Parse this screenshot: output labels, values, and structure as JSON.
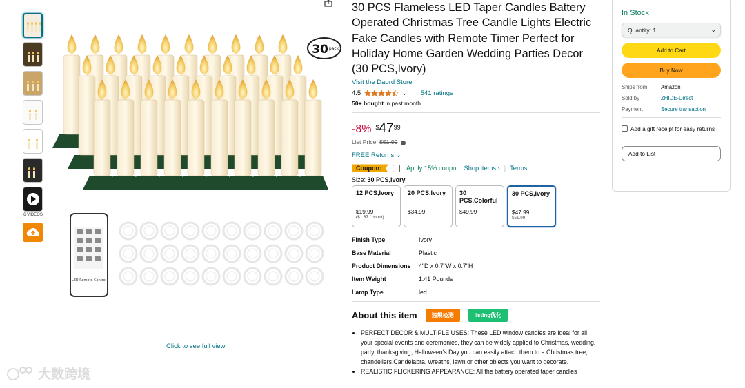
{
  "gallery": {
    "videos_label": "6 VIDEOS",
    "click_full_view": "Click to see full view",
    "badge_number": "30",
    "badge_text": "pack",
    "remote_label": "LED Remote Control"
  },
  "product": {
    "title": "30 PCS Flameless LED Taper Candles Battery Operated Christmas Tree Candle Lights Electric Fake Candles with Remote Timer Perfect for Holiday Home Garden Wedding Parties Decor (30 PCS,Ivory)",
    "store_link": "Visit the Daord Store",
    "rating": "4.5",
    "stars_value": 4.5,
    "ratings_count": "541 ratings",
    "bought_bold": "50+ bought",
    "bought_rest": " in past month",
    "discount": "-8%",
    "price_symbol": "$",
    "price_whole": "47",
    "price_fraction": "99",
    "list_price_label": "List Price: ",
    "list_price": "$51.99",
    "returns": "FREE Returns",
    "coupon_badge": "Coupon:",
    "coupon_apply": "Apply 15% coupon",
    "shop_items": "Shop items ›",
    "separator": "|",
    "terms": "Terms",
    "size_label": "Size: ",
    "size_selected": "30 PCS,Ivory"
  },
  "sizes": [
    {
      "name": "12 PCS,Ivory",
      "price": "$19.99",
      "sub": "($1.67 / count)",
      "strike": ""
    },
    {
      "name": "20 PCS,Ivory",
      "price": "$34.99",
      "sub": "",
      "strike": ""
    },
    {
      "name": "30 PCS,Colorful",
      "price": "$49.99",
      "sub": "",
      "strike": ""
    },
    {
      "name": "30 PCS,Ivory",
      "price": "$47.99",
      "sub": "",
      "strike": "$51.99"
    }
  ],
  "specs": [
    {
      "key": "Finish Type",
      "value": "Ivory"
    },
    {
      "key": "Base Material",
      "value": "Plastic"
    },
    {
      "key": "Product Dimensions",
      "value": "4\"D x 0.7\"W x 0.7\"H"
    },
    {
      "key": "Item Weight",
      "value": "1.41 Pounds"
    },
    {
      "key": "Lamp Type",
      "value": "led"
    }
  ],
  "about": {
    "title": "About this item",
    "tag1": "违规检测",
    "tag2": "listing优化",
    "bullets": [
      "PERFECT DECOR & MULTIPLE USES: These LED window candles are ideal for all your special events and ceremonies, they can be widely applied to Christmas, wedding, party, thanksgiving, Halloween's Day you can easily attach them to a Christmas tree, chandeliers,Candelabra, wreaths, lawn or other objects you want to decorate.",
      "REALISTIC FLICKERING APPEARANCE: All the battery operated taper candles"
    ]
  },
  "buybox": {
    "stock": "In Stock",
    "quantity": "Quantity: 1",
    "add_to_cart": "Add to Cart",
    "buy_now": "Buy Now",
    "ships_from_label": "Ships from",
    "ships_from": "Amazon",
    "sold_by_label": "Sold by",
    "sold_by": "ZHIDE-Direct",
    "payment_label": "Payment",
    "payment": "Secure transaction",
    "gift": "Add a gift receipt for easy returns",
    "add_to_list": "Add to List"
  },
  "watermark": "大数跨境",
  "colors": {
    "link": "#007185",
    "stock": "#067d62",
    "discount": "#cc0c39",
    "cart": "#ffd814",
    "buy": "#ffa41c",
    "star": "#de7921",
    "coupon": "#f0a800"
  }
}
